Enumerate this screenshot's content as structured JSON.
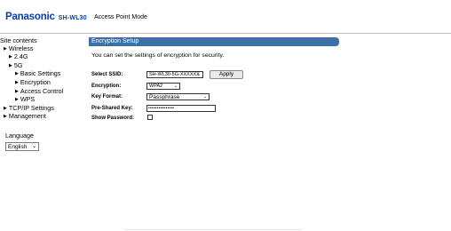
{
  "header": {
    "brand": "Panasonic",
    "model": "SH-WL30",
    "mode": "Access Point Mode"
  },
  "sidebar": {
    "title": "Site contents",
    "items": [
      {
        "label": "Wireless",
        "marker": "▶"
      },
      {
        "label": "2.4G",
        "marker": "▶"
      },
      {
        "label": "5G",
        "marker": "▶"
      },
      {
        "label": "Basic Settings",
        "marker": "▶"
      },
      {
        "label": "Encryption",
        "marker": "▶"
      },
      {
        "label": "Access Control",
        "marker": "▶"
      },
      {
        "label": "WPS",
        "marker": "▶"
      },
      {
        "label": "TCP/IP Settings",
        "marker": "▶"
      },
      {
        "label": "Management",
        "marker": "▶"
      }
    ],
    "language_label": "Language",
    "language_value": "English"
  },
  "main": {
    "title": "Encryption Setup",
    "description": "You can set the settings of encryption for security.",
    "form": {
      "ssid_label": "Select SSID:",
      "ssid_value": "SH-WL30-5G-XXXXXX",
      "apply_label": "Apply",
      "encryption_label": "Encryption:",
      "encryption_value": "WPA2",
      "key_format_label": "Key Format:",
      "key_format_value": "Passphrase",
      "psk_label": "Pre-Shared Key:",
      "psk_value": "•••••••••••••••",
      "show_password_label": "Show Password:",
      "show_password_checked": false
    }
  },
  "colors": {
    "brand": "#0a3f9c",
    "titlebar": "#3d6ea8"
  },
  "icons": {
    "tree_marker": "triangle-right-icon",
    "dropdown": "chevron-down-icon"
  }
}
